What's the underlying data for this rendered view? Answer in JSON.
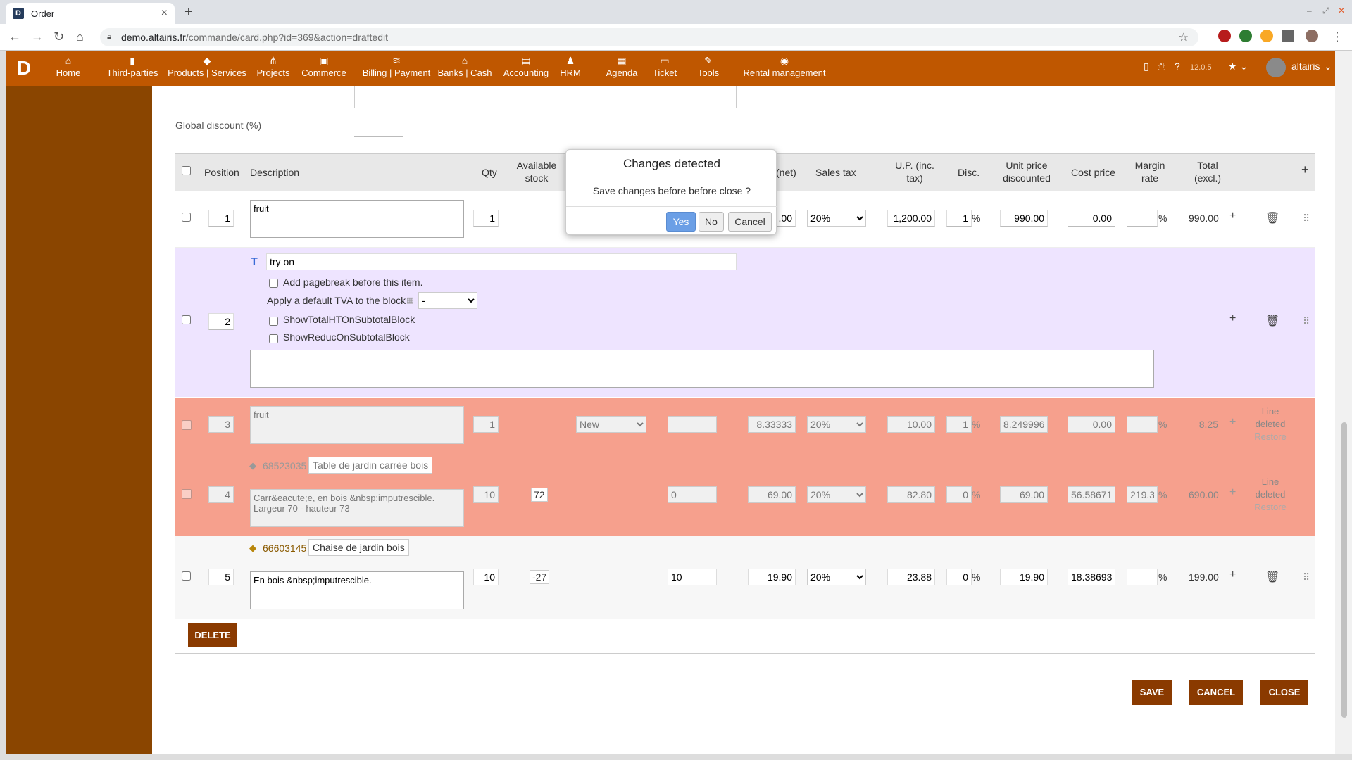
{
  "browser": {
    "tab_title": "Order",
    "url_host": "demo.altairis.fr",
    "url_path": "/commande/card.php?id=369&action=draftedit",
    "new_tab": "+",
    "close_tab": "×"
  },
  "nav": {
    "items": [
      {
        "label": "Home",
        "icon": "⌂"
      },
      {
        "label": "Third-parties",
        "icon": "▮"
      },
      {
        "label": "Products | Services",
        "icon": "◆"
      },
      {
        "label": "Projects",
        "icon": "⋔"
      },
      {
        "label": "Commerce",
        "icon": "▣"
      },
      {
        "label": "Billing | Payment",
        "icon": "≋"
      },
      {
        "label": "Banks | Cash",
        "icon": "⌂"
      },
      {
        "label": "Accounting",
        "icon": "▤"
      },
      {
        "label": "HRM",
        "icon": "♟"
      },
      {
        "label": "Agenda",
        "icon": "▦"
      },
      {
        "label": "Ticket",
        "icon": "▭"
      },
      {
        "label": "Tools",
        "icon": "✎"
      },
      {
        "label": "Rental management",
        "icon": "◉"
      }
    ],
    "version": "12.0.5",
    "user": "altairis",
    "brand_color": "#bf5700"
  },
  "form": {
    "global_discount_label": "Global discount (%)"
  },
  "table": {
    "headers": {
      "position": "Position",
      "description": "Description",
      "qty": "Qty",
      "available_stock_1": "Available",
      "available_stock_2": "stock",
      "net_partial": "(net)",
      "sales_tax": "Sales tax",
      "up_inc_1": "U.P. (inc.",
      "up_inc_2": "tax)",
      "disc": "Disc.",
      "unit_disc_1": "Unit price",
      "unit_disc_2": "discounted",
      "cost_price": "Cost price",
      "margin_1": "Margin",
      "margin_2": "rate",
      "total_1": "Total",
      "total_2": "(excl.)",
      "add": "+"
    },
    "row1": {
      "pos": "1",
      "desc": "fruit",
      "qty": "1",
      "net": ".00",
      "tax": "20%",
      "up_inc": "1,200.00",
      "disc": "1",
      "unit_disc": "990.00",
      "cost": "0.00",
      "margin": "",
      "total": "990.00"
    },
    "row2": {
      "pos": "2",
      "title": "try on",
      "pagebreak_label": "Add pagebreak before this item.",
      "tva_label": "Apply a default TVA to the block",
      "tva_value": "-",
      "show_total_label": "ShowTotalHTOnSubtotalBlock",
      "show_reduc_label": "ShowReducOnSubtotalBlock"
    },
    "row3": {
      "pos": "3",
      "desc": "fruit",
      "qty": "1",
      "status": "New",
      "net": "8.33333",
      "tax": "20%",
      "up_inc": "10.00",
      "disc": "1",
      "unit_disc": "8.249996",
      "cost": "0.00",
      "margin": "",
      "total": "8.25",
      "deleted_1": "Line",
      "deleted_2": "deleted",
      "restore": "Restore"
    },
    "row4": {
      "pos": "4",
      "ref": "68523035",
      "name": "Table de jardin carrée bois",
      "desc": "Carr&eacute;e, en bois &nbsp;imputrescible.\nLargeur 70 - hauteur 73",
      "qty": "10",
      "stock": "72",
      "buy": "0",
      "net": "69.00",
      "tax": "20%",
      "up_inc": "82.80",
      "disc": "0",
      "unit_disc": "69.00",
      "cost": "56.58671",
      "margin": "219.3",
      "total": "690.00",
      "deleted_1": "Line",
      "deleted_2": "deleted",
      "restore": "Restore"
    },
    "row5": {
      "pos": "5",
      "ref": "66603145",
      "name": "Chaise de jardin bois",
      "desc": "En bois &nbsp;imputrescible.",
      "qty": "10",
      "stock": "-27",
      "buy": "10",
      "net": "19.90",
      "tax": "20%",
      "up_inc": "23.88",
      "disc": "0",
      "unit_disc": "19.90",
      "cost": "18.38693",
      "margin": "",
      "total": "199.00"
    },
    "percent": "%"
  },
  "buttons": {
    "delete": "DELETE",
    "save": "SAVE",
    "cancel": "CANCEL",
    "close": "CLOSE"
  },
  "modal": {
    "title": "Changes detected",
    "message": "Save changes before before close ?",
    "yes": "Yes",
    "no": "No",
    "cancel": "Cancel"
  }
}
